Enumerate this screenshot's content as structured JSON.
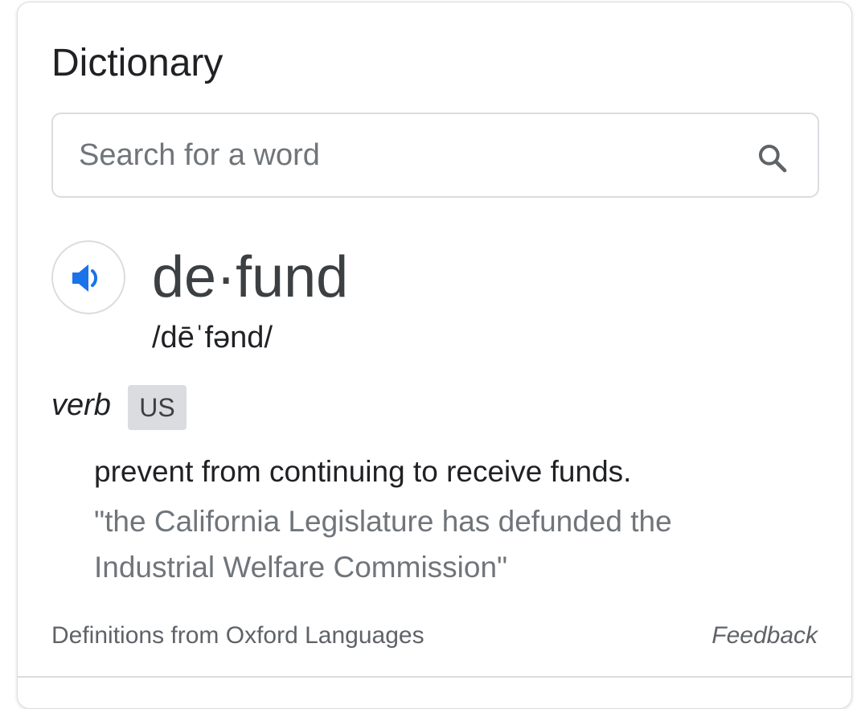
{
  "card": {
    "title": "Dictionary"
  },
  "search": {
    "placeholder": "Search for a word",
    "value": "",
    "icon": "search-icon"
  },
  "entry": {
    "speaker_icon": "volume-icon",
    "headword": "de·fund",
    "phonetic": "/dēˈfənd/",
    "part_of_speech": "verb",
    "region_badge": "US",
    "definition": "prevent from continuing to receive funds.",
    "example": "\"the California Legislature has defunded the Industrial Welfare Commission\""
  },
  "footer": {
    "source": "Definitions from Oxford Languages",
    "feedback": "Feedback"
  },
  "colors": {
    "accent": "#1a73e8",
    "text_primary": "#202124",
    "text_secondary": "#70757a",
    "border": "#dadce0"
  }
}
